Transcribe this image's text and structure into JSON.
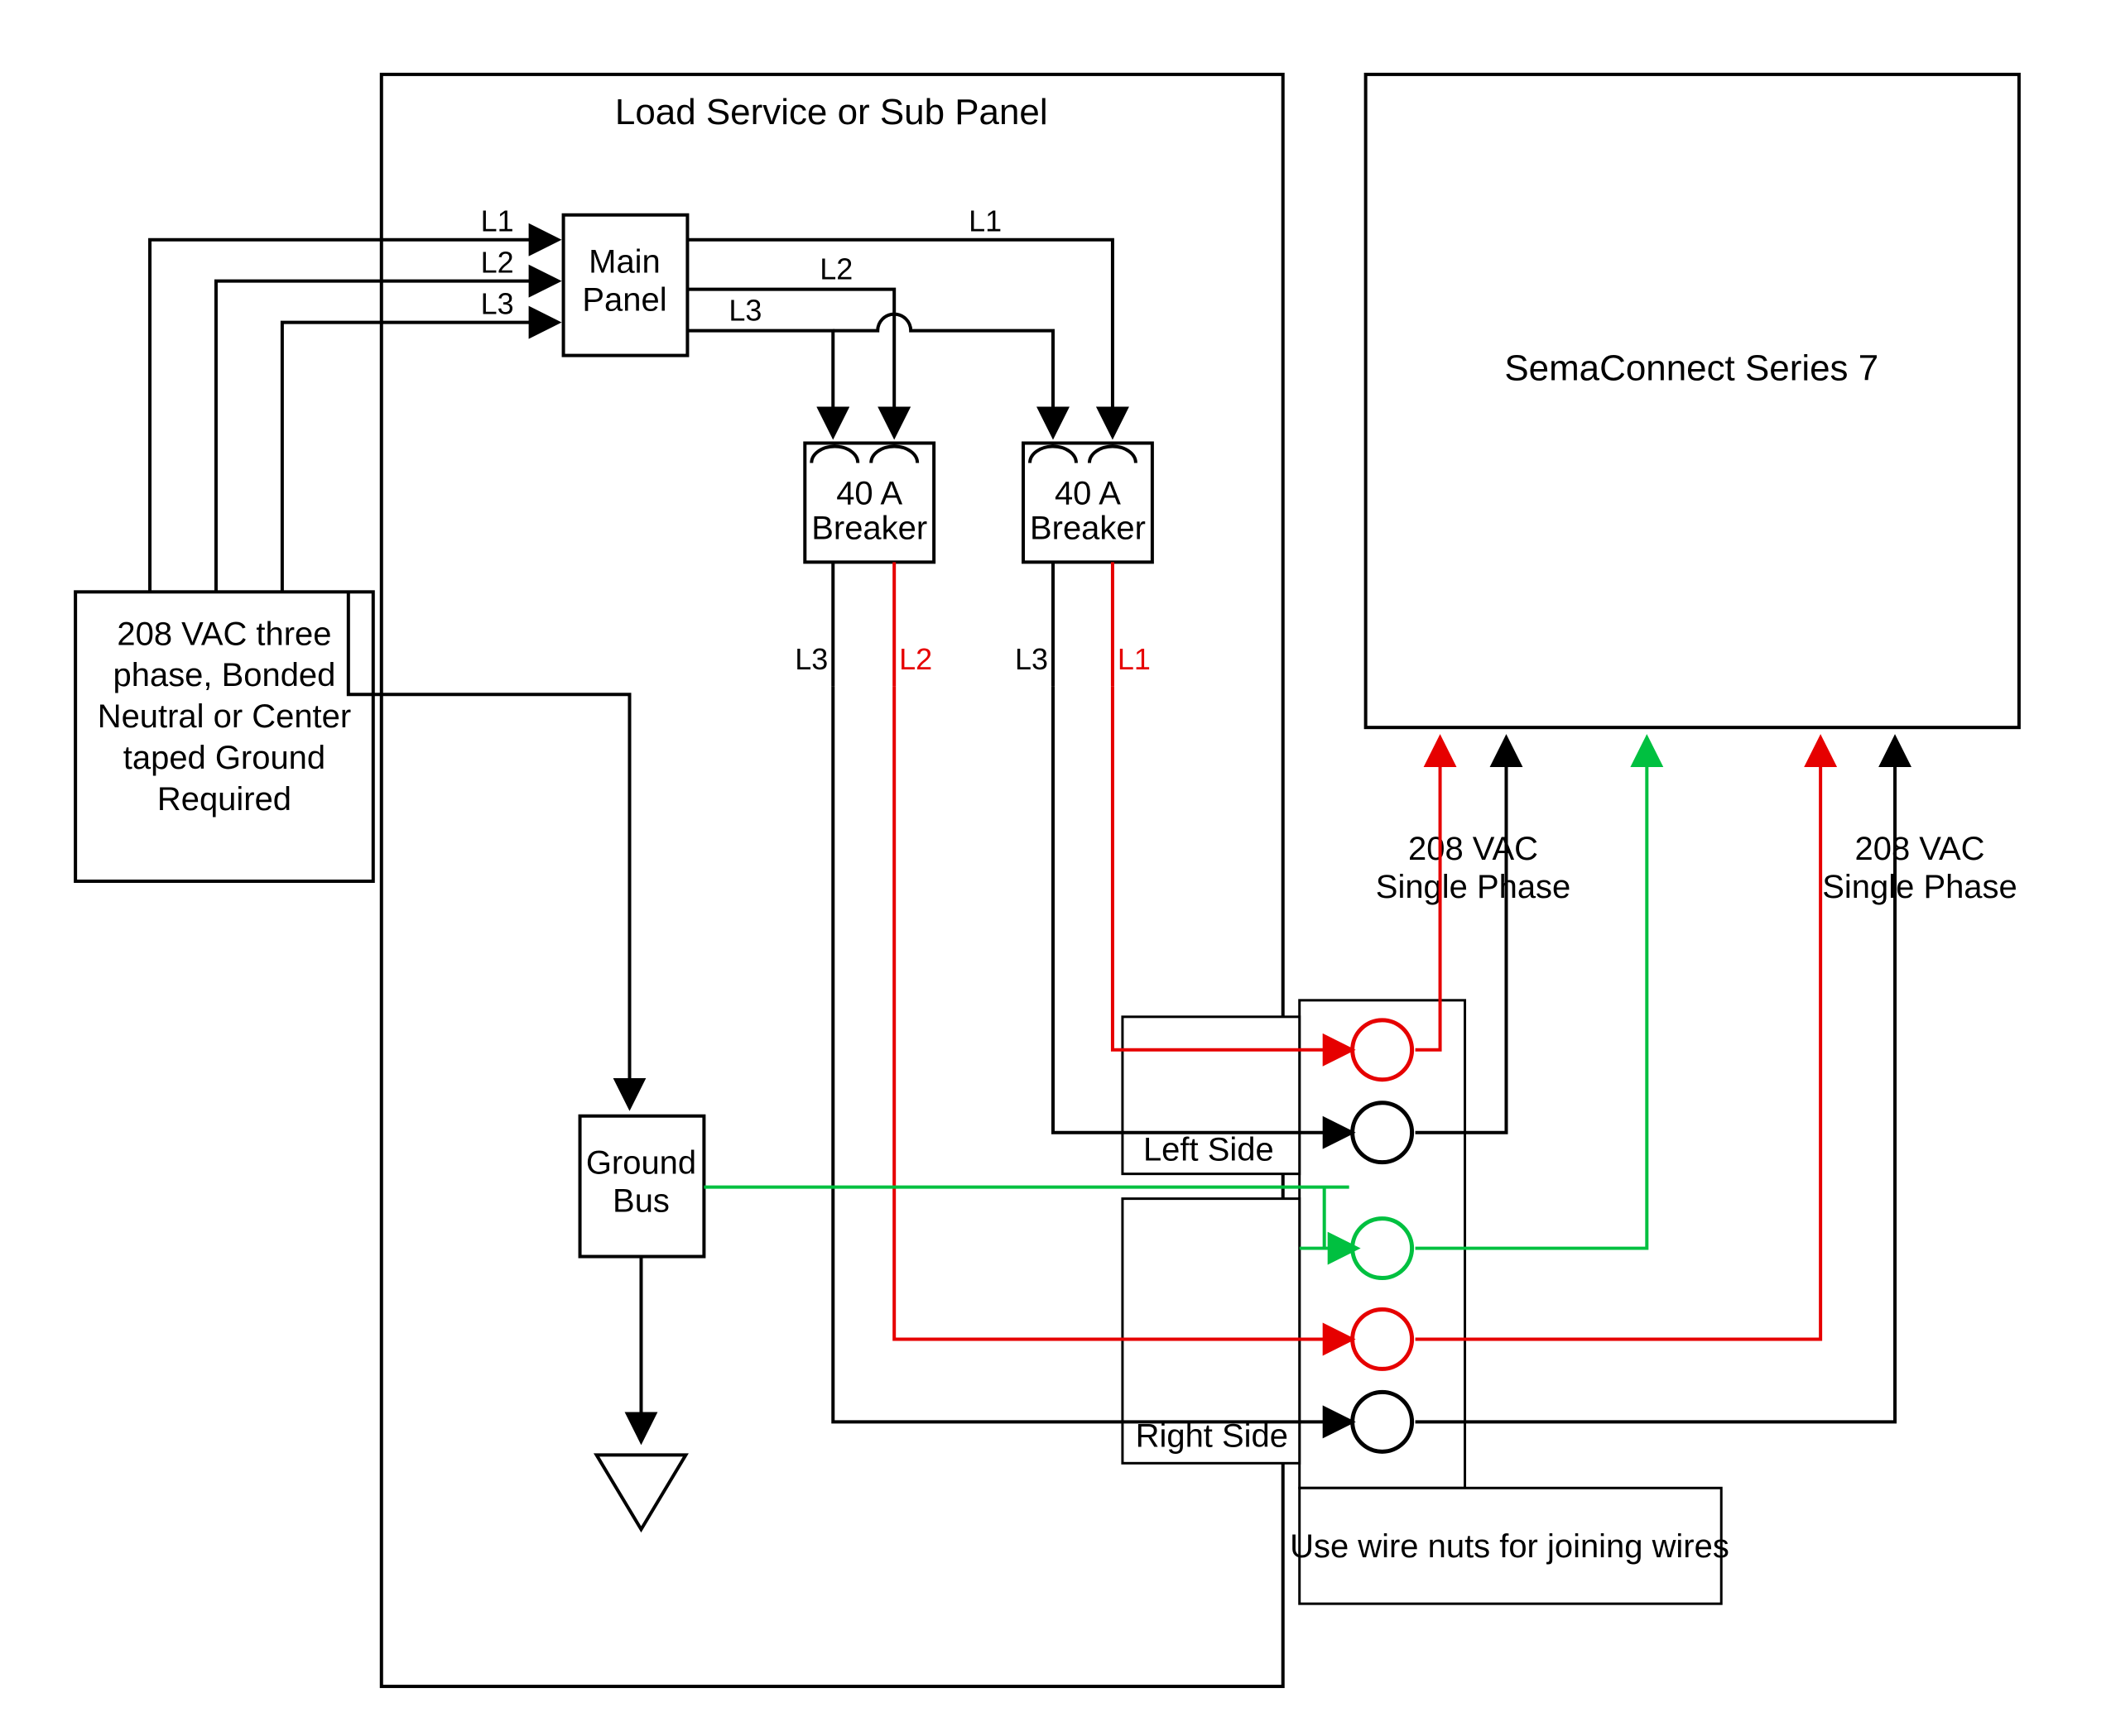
{
  "title": "Load Service or Sub Panel",
  "source": {
    "line1": "208 VAC three",
    "line2": "phase, Bonded",
    "line3": "Neutral or Center",
    "line4": "taped Ground",
    "line5": "Required"
  },
  "main_panel": {
    "line1": "Main",
    "line2": "Panel"
  },
  "breaker1": {
    "line1": "40 A",
    "line2": "Breaker"
  },
  "breaker2": {
    "line1": "40 A",
    "line2": "Breaker"
  },
  "ground_bus": {
    "line1": "Ground",
    "line2": "Bus"
  },
  "device": "SemaConnect Series 7",
  "vac_label1": {
    "line1": "208 VAC",
    "line2": "Single Phase"
  },
  "vac_label2": {
    "line1": "208 VAC",
    "line2": "Single Phase"
  },
  "left_side": "Left Side",
  "right_side": "Right Side",
  "wire_nuts": "Use wire nuts for joining wires",
  "phase_labels": {
    "L1": "L1",
    "L2": "L2",
    "L3": "L3"
  }
}
